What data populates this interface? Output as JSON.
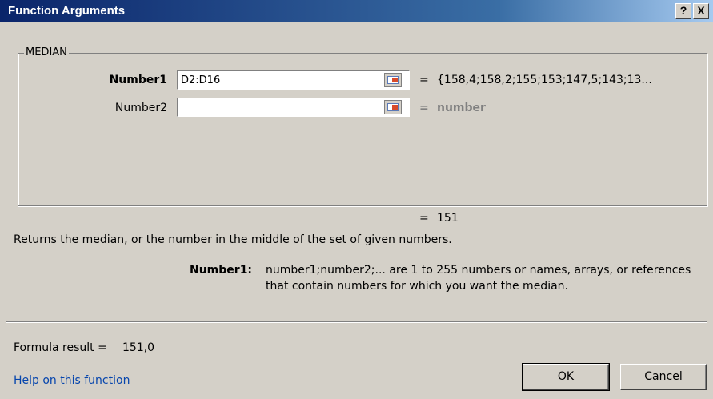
{
  "window": {
    "title": "Function Arguments",
    "help_glyph": "?",
    "close_glyph": "X"
  },
  "group": {
    "label": "MEDIAN"
  },
  "args": [
    {
      "label": "Number1",
      "value": "D2:D16",
      "placeholder": "",
      "result": "{158,4;158,2;155;153;147,5;143;13..."
    },
    {
      "label": "Number2",
      "value": "",
      "placeholder": "",
      "result": "number"
    }
  ],
  "equals_sign": "=",
  "summary_result": "151",
  "description": "Returns the median, or the number in the middle of the set of given numbers.",
  "arg_help": {
    "name": "Number1:",
    "line1": "number1;number2;... are 1 to 255 numbers or names, arrays, or references",
    "line2": "that contain numbers for which you want the median."
  },
  "formula_result": {
    "label": "Formula result =",
    "value": "151,0"
  },
  "help_link": "Help on this function",
  "buttons": {
    "ok": "OK",
    "cancel": "Cancel"
  }
}
